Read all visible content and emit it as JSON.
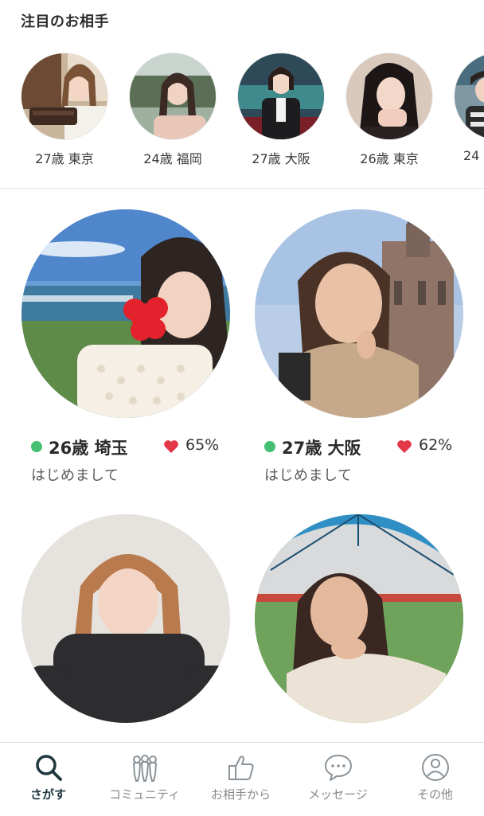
{
  "featured": {
    "title": "注目のお相手",
    "items": [
      {
        "caption": "27歳 東京"
      },
      {
        "caption": "24歳 福岡"
      },
      {
        "caption": "27歳 大阪"
      },
      {
        "caption": "26歳 東京"
      },
      {
        "caption": "24"
      }
    ]
  },
  "cards": [
    {
      "age_place": "26歳 埼玉",
      "match": "65%",
      "message": "はじめまして"
    },
    {
      "age_place": "27歳 大阪",
      "match": "62%",
      "message": "はじめまして"
    },
    {
      "age_place": "",
      "match": "",
      "message": ""
    },
    {
      "age_place": "",
      "match": "",
      "message": ""
    }
  ],
  "nav": {
    "items": [
      {
        "label": "さがす",
        "icon": "search-icon",
        "active": true
      },
      {
        "label": "コミュニティ",
        "icon": "community-icon",
        "active": false
      },
      {
        "label": "お相手から",
        "icon": "thumbs-up-icon",
        "active": false
      },
      {
        "label": "メッセージ",
        "icon": "message-icon",
        "active": false
      },
      {
        "label": "その他",
        "icon": "user-circle-icon",
        "active": false
      }
    ]
  },
  "colors": {
    "online": "#46c173",
    "heart": "#e3374a",
    "nav_active": "#1f3840",
    "nav_inactive": "#8a9399"
  }
}
